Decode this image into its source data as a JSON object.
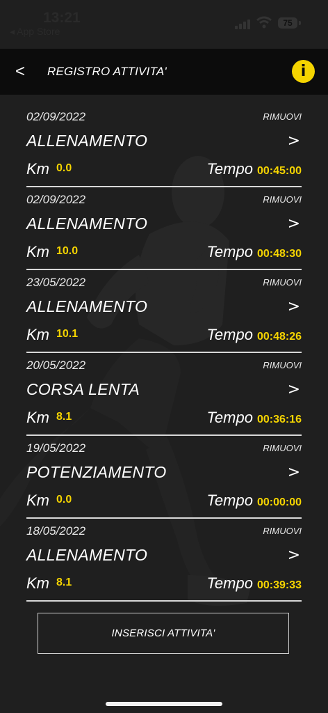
{
  "status_bar": {
    "time": "13:21",
    "back_app": "◂ App Store",
    "battery": "75"
  },
  "header": {
    "back_glyph": "<",
    "title": "REGISTRO ATTIVITA'",
    "info_glyph": "i"
  },
  "labels": {
    "remove": "RIMUOVI",
    "km": "Km",
    "tempo": "Tempo",
    "chevron": ">"
  },
  "entries": [
    {
      "date": "02/09/2022",
      "name": "ALLENAMENTO",
      "km": "0.0",
      "time": "00:45:00"
    },
    {
      "date": "02/09/2022",
      "name": "ALLENAMENTO",
      "km": "10.0",
      "time": "00:48:30"
    },
    {
      "date": "23/05/2022",
      "name": "ALLENAMENTO",
      "km": "10.1",
      "time": "00:48:26"
    },
    {
      "date": "20/05/2022",
      "name": "CORSA LENTA",
      "km": "8.1",
      "time": "00:36:16"
    },
    {
      "date": "19/05/2022",
      "name": "POTENZIAMENTO",
      "km": "0.0",
      "time": "00:00:00"
    },
    {
      "date": "18/05/2022",
      "name": "ALLENAMENTO",
      "km": "8.1",
      "time": "00:39:33"
    }
  ],
  "add_button": {
    "label": "INSERISCI ATTIVITA'"
  },
  "colors": {
    "accent": "#f5d400",
    "background": "#1f1f1f",
    "header": "#0c0c0c"
  }
}
